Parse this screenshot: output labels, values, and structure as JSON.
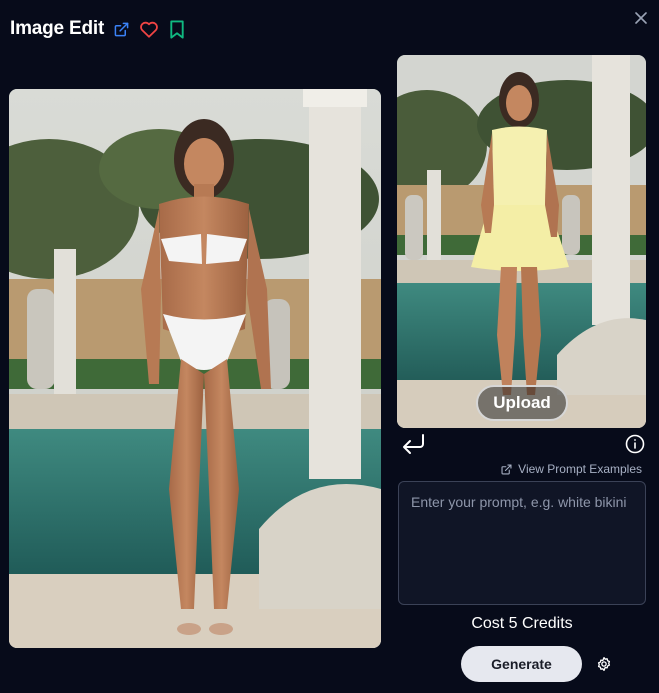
{
  "header": {
    "title": "Image Edit",
    "icons": [
      "external-link-icon",
      "heart-icon",
      "bookmark-icon"
    ],
    "close_icon": "close-icon"
  },
  "main_image": {
    "alt": "Generated image of a woman in a white bikini by a pool"
  },
  "reference_image": {
    "alt": "Reference image of a woman in a yellow dress by a pool",
    "upload_label": "Upload"
  },
  "prompt": {
    "examples_link": "View Prompt Examples",
    "placeholder": "Enter your prompt, e.g. white bikini",
    "value": ""
  },
  "cost_text": "Cost 5 Credits",
  "generate_label": "Generate",
  "colors": {
    "background": "#070b1a",
    "link_icon": "#3b82f6",
    "heart": "#ef4444",
    "bookmark": "#10b981",
    "button_bg": "#e6e8ef"
  }
}
